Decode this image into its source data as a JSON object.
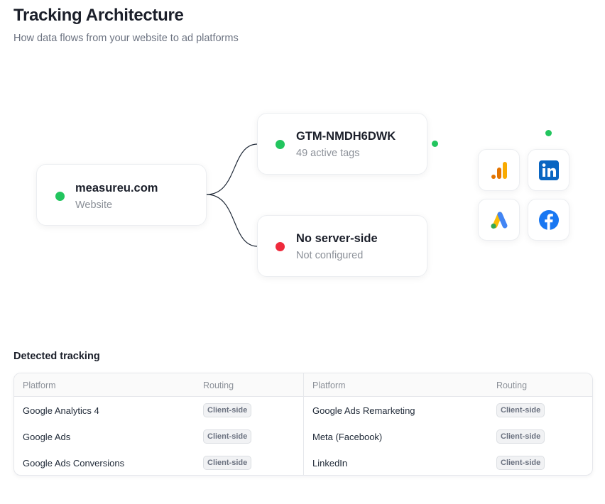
{
  "header": {
    "title": "Tracking Architecture",
    "subtitle": "How data flows from your website to ad platforms"
  },
  "diagram": {
    "website": {
      "title": "measureu.com",
      "subtitle": "Website",
      "status_color": "#22c55e"
    },
    "gtm": {
      "title": "GTM-NMDH6DWK",
      "subtitle": "49 active tags",
      "status_color": "#22c55e"
    },
    "server": {
      "title": "No server-side",
      "subtitle": "Not configured",
      "status_color": "#ef2a3c"
    },
    "platforms": [
      {
        "icon": "google-analytics-icon"
      },
      {
        "icon": "linkedin-icon"
      },
      {
        "icon": "google-ads-icon"
      },
      {
        "icon": "facebook-icon"
      }
    ]
  },
  "detected": {
    "title": "Detected tracking",
    "columns": {
      "platform": "Platform",
      "routing": "Routing"
    },
    "left": [
      {
        "platform": "Google Analytics 4",
        "routing": "Client-side"
      },
      {
        "platform": "Google Ads",
        "routing": "Client-side"
      },
      {
        "platform": "Google Ads Conversions",
        "routing": "Client-side"
      }
    ],
    "right": [
      {
        "platform": "Google Ads Remarketing",
        "routing": "Client-side"
      },
      {
        "platform": "Meta (Facebook)",
        "routing": "Client-side"
      },
      {
        "platform": "LinkedIn",
        "routing": "Client-side"
      }
    ]
  },
  "colors": {
    "ok": "#22c55e",
    "error": "#ef2a3c",
    "linkedin": "#0a66c2",
    "facebook": "#1877f2",
    "ga_orange": "#f9ab00",
    "ga_dark": "#e37400"
  }
}
